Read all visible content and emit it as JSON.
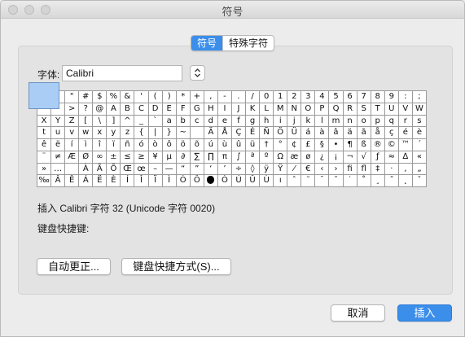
{
  "window": {
    "title": "符号"
  },
  "tabs": [
    {
      "label": "符号",
      "active": true
    },
    {
      "label": "特殊字符",
      "active": false
    }
  ],
  "font": {
    "label": "字体:",
    "value": "Calibri"
  },
  "colors": {
    "accent": "#3b8eea",
    "selection": "#a9cdf5"
  },
  "symbols": [
    [
      "",
      "",
      "\"",
      "#",
      "$",
      "%",
      "&",
      "'",
      "(",
      ")",
      "*",
      "+",
      ",",
      "-",
      ".",
      "/",
      "0",
      "1",
      "2",
      "3",
      "4",
      "5",
      "6",
      "7",
      "8",
      "9",
      ":",
      ";"
    ],
    [
      "",
      "",
      ">",
      "?",
      "@",
      "A",
      "B",
      "C",
      "D",
      "E",
      "F",
      "G",
      "H",
      "I",
      "J",
      "K",
      "L",
      "M",
      "N",
      "O",
      "P",
      "Q",
      "R",
      "S",
      "T",
      "U",
      "V",
      "W"
    ],
    [
      "X",
      "Y",
      "Z",
      "[",
      "\\",
      "]",
      "^",
      "_",
      "`",
      "a",
      "b",
      "c",
      "d",
      "e",
      "f",
      "g",
      "h",
      "i",
      "j",
      "k",
      "l",
      "m",
      "n",
      "o",
      "p",
      "q",
      "r",
      "s"
    ],
    [
      "t",
      "u",
      "v",
      "w",
      "x",
      "y",
      "z",
      "{",
      "|",
      "}",
      "~",
      "",
      "Ä",
      "Å",
      "Ç",
      "É",
      "Ñ",
      "Ö",
      "Ü",
      "á",
      "à",
      "â",
      "ä",
      "ã",
      "å",
      "ç",
      "é",
      "è"
    ],
    [
      "ê",
      "ë",
      "í",
      "ì",
      "î",
      "ï",
      "ñ",
      "ó",
      "ò",
      "ô",
      "ö",
      "õ",
      "ú",
      "ù",
      "û",
      "ü",
      "†",
      "°",
      "¢",
      "£",
      "§",
      "•",
      "¶",
      "ß",
      "®",
      "©",
      "™",
      "´"
    ],
    [
      "¨",
      "≠",
      "Æ",
      "Ø",
      "∞",
      "±",
      "≤",
      "≥",
      "¥",
      "µ",
      "∂",
      "∑",
      "∏",
      "π",
      "∫",
      "ª",
      "º",
      "Ω",
      "æ",
      "ø",
      "¿",
      "¡",
      "¬",
      "√",
      "ƒ",
      "≈",
      "∆",
      "«"
    ],
    [
      "»",
      "…",
      "",
      "À",
      "Ã",
      "Õ",
      "Œ",
      "œ",
      "–",
      "—",
      "“",
      "”",
      "‘",
      "’",
      "÷",
      "◊",
      "ÿ",
      "Ÿ",
      "⁄",
      "€",
      "‹",
      "›",
      "ﬁ",
      "ﬂ",
      "‡",
      "·",
      "‚",
      "„"
    ],
    [
      "‰",
      "Â",
      "Ê",
      "Á",
      "Ë",
      "È",
      "Í",
      "Î",
      "Ï",
      "Ì",
      "Ó",
      "Ô",
      "",
      "Ò",
      "Ú",
      "Û",
      "Ù",
      "ı",
      "ˆ",
      "˜",
      "¯",
      "˘",
      "˙",
      "˚",
      "¸",
      "˝",
      "˛",
      "ˇ"
    ]
  ],
  "insert_info": "插入 Calibri 字符 32 (Unicode 字符 0020)",
  "shortcut_label": "键盘快捷键:",
  "buttons": {
    "autocorrect": "自动更正...",
    "keyboard_shortcut": "键盘快捷方式(S)...",
    "cancel": "取消",
    "insert": "插入"
  }
}
